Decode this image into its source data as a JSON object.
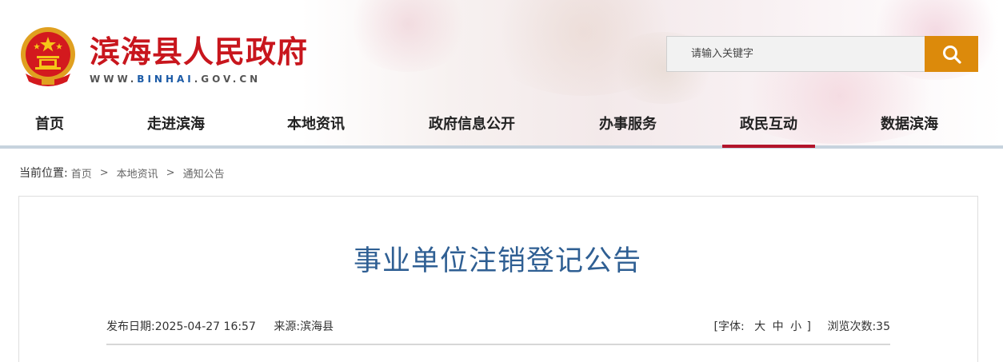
{
  "header": {
    "site_title": "滨海县人民政府",
    "site_url_prefix": "WWW.",
    "site_url_highlight": "BINHAI",
    "site_url_suffix": ".GOV.CN",
    "brand_color": "#c8161d"
  },
  "search": {
    "placeholder": "请输入关键字",
    "button_icon": "search-icon",
    "button_color": "#dc8a0b"
  },
  "nav": {
    "items": [
      {
        "label": "首页"
      },
      {
        "label": "走进滨海"
      },
      {
        "label": "本地资讯"
      },
      {
        "label": "政府信息公开"
      },
      {
        "label": "办事服务"
      },
      {
        "label": "政民互动",
        "active": true
      },
      {
        "label": "数据滨海"
      }
    ],
    "active_color": "#b3142b"
  },
  "breadcrumb": {
    "label": "当前位置:",
    "items": [
      "首页",
      "本地资讯",
      "通知公告"
    ],
    "separator": ">"
  },
  "article": {
    "title": "事业单位注销登记公告",
    "publish_label": "发布日期:",
    "publish_date": "2025-04-27 16:57",
    "source_label": "来源:",
    "source": "滨海县",
    "font_label_open": "[字体:",
    "font_large": "大",
    "font_medium": "中",
    "font_small": "小",
    "font_label_close": "]",
    "views_label": "浏览次数:",
    "views": "35",
    "title_color": "#2f5f93"
  }
}
